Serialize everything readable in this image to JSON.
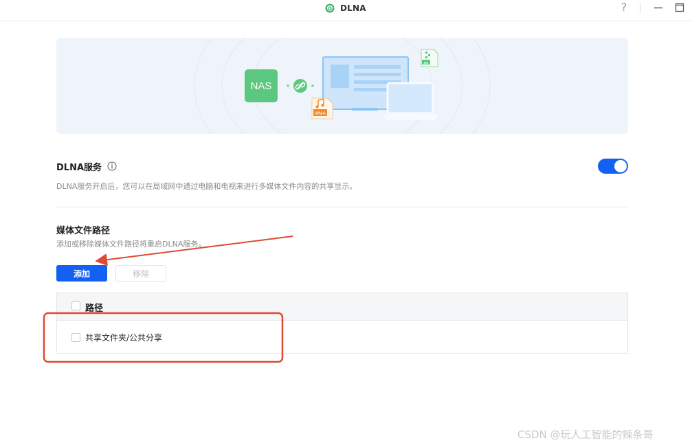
{
  "window": {
    "title": "DLNA",
    "app_icon": "dlna-app-icon",
    "help_glyph": "?"
  },
  "banner": {
    "nas_label": "NAS",
    "file_badge_music": "WMA",
    "file_badge_image": "jpg"
  },
  "dlna_service": {
    "title": "DLNA服务",
    "description": "DLNA服务开启后，您可以在局域网中通过电脑和电视来进行多媒体文件内容的共享显示。",
    "enabled": true
  },
  "media_path": {
    "title": "媒体文件路径",
    "description": "添加或移除媒体文件路径将重启DLNA服务。",
    "add_label": "添加",
    "remove_label": "移除"
  },
  "table": {
    "column_header": "路径",
    "rows": [
      {
        "path": "共享文件夹/公共分享"
      }
    ]
  },
  "colors": {
    "accent": "#1360f2",
    "nas_green": "#5cc87f",
    "annotation_red": "#e04a32"
  },
  "watermark": "CSDN @玩人工智能的辣条哥"
}
